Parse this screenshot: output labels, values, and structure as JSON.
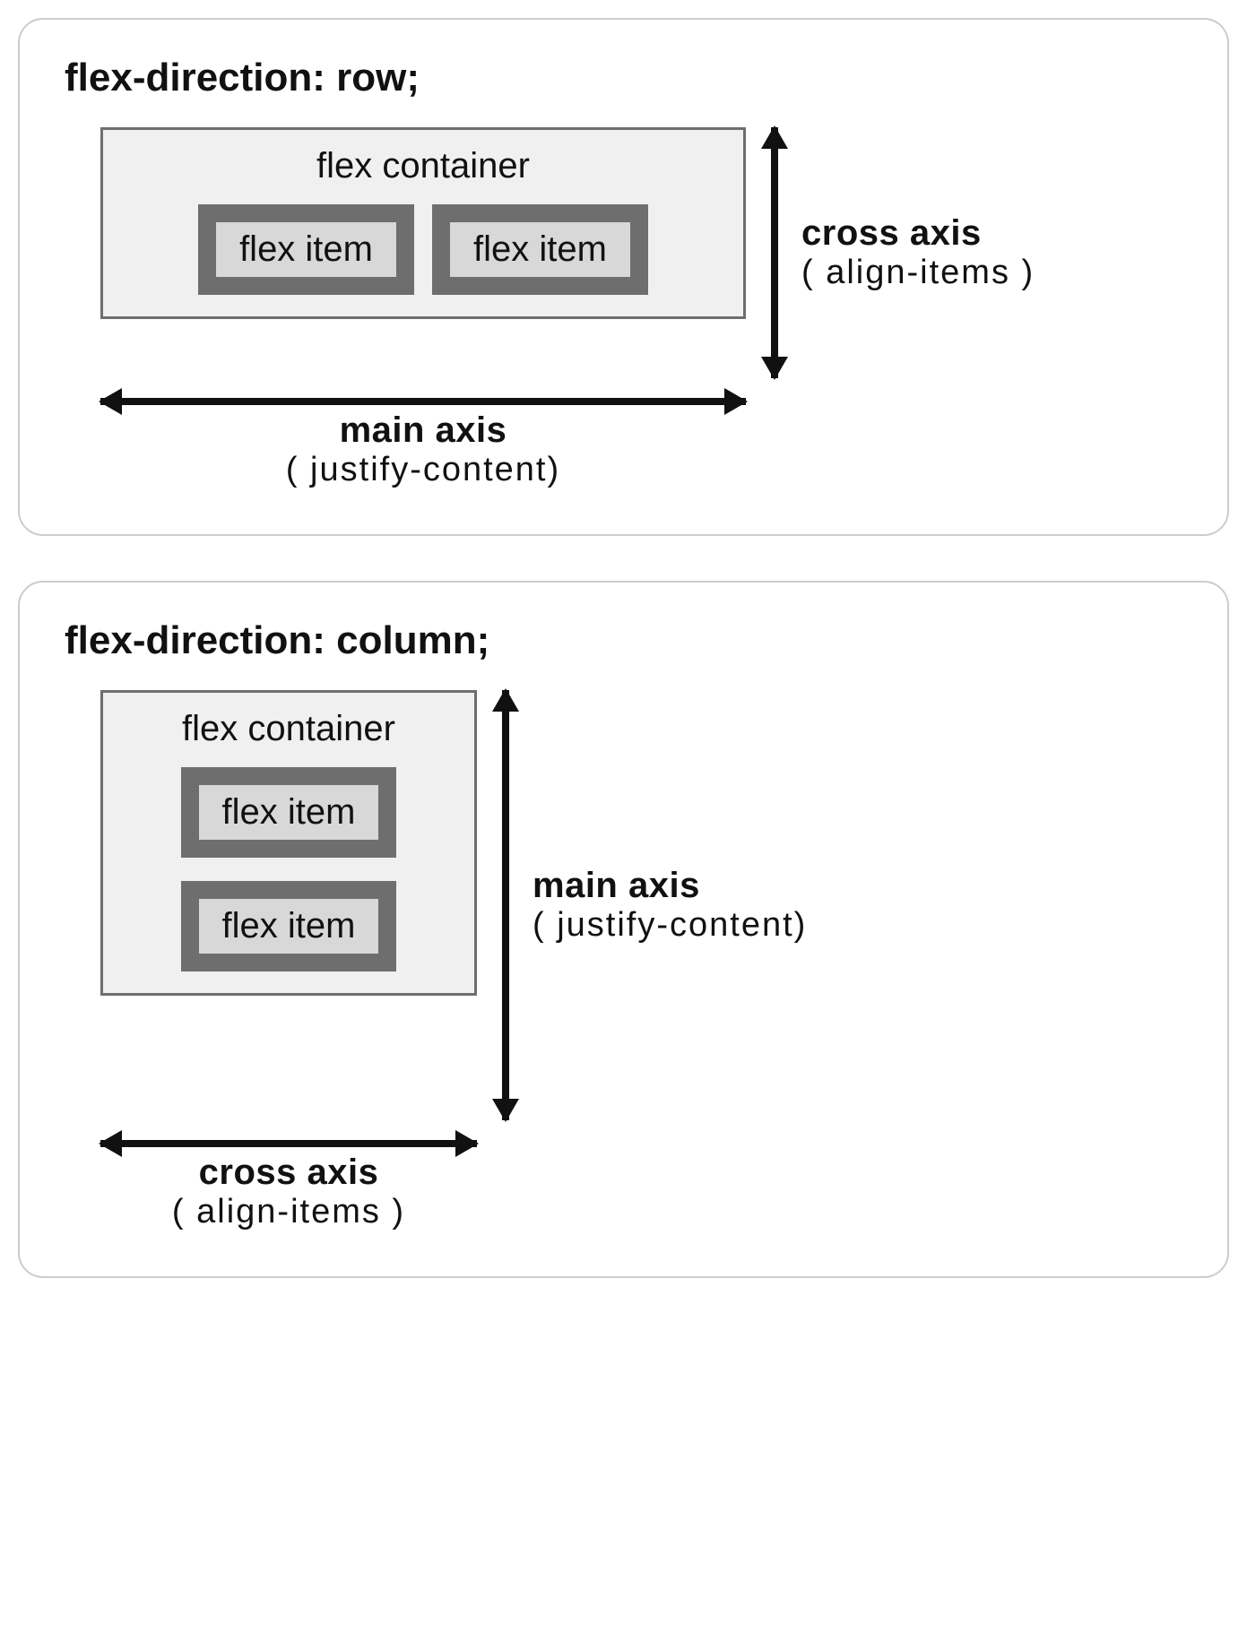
{
  "panels": [
    {
      "title": "flex-direction: row;",
      "container_label": "flex container",
      "item_label": "flex item",
      "main_axis": {
        "title": "main axis",
        "sub": "( justify-content)"
      },
      "cross_axis": {
        "title": "cross axis",
        "sub": "( align-items )"
      }
    },
    {
      "title": "flex-direction: column;",
      "container_label": "flex container",
      "item_label": "flex item",
      "main_axis": {
        "title": "main axis",
        "sub": "( justify-content)"
      },
      "cross_axis": {
        "title": "cross axis",
        "sub": "( align-items )"
      }
    }
  ]
}
